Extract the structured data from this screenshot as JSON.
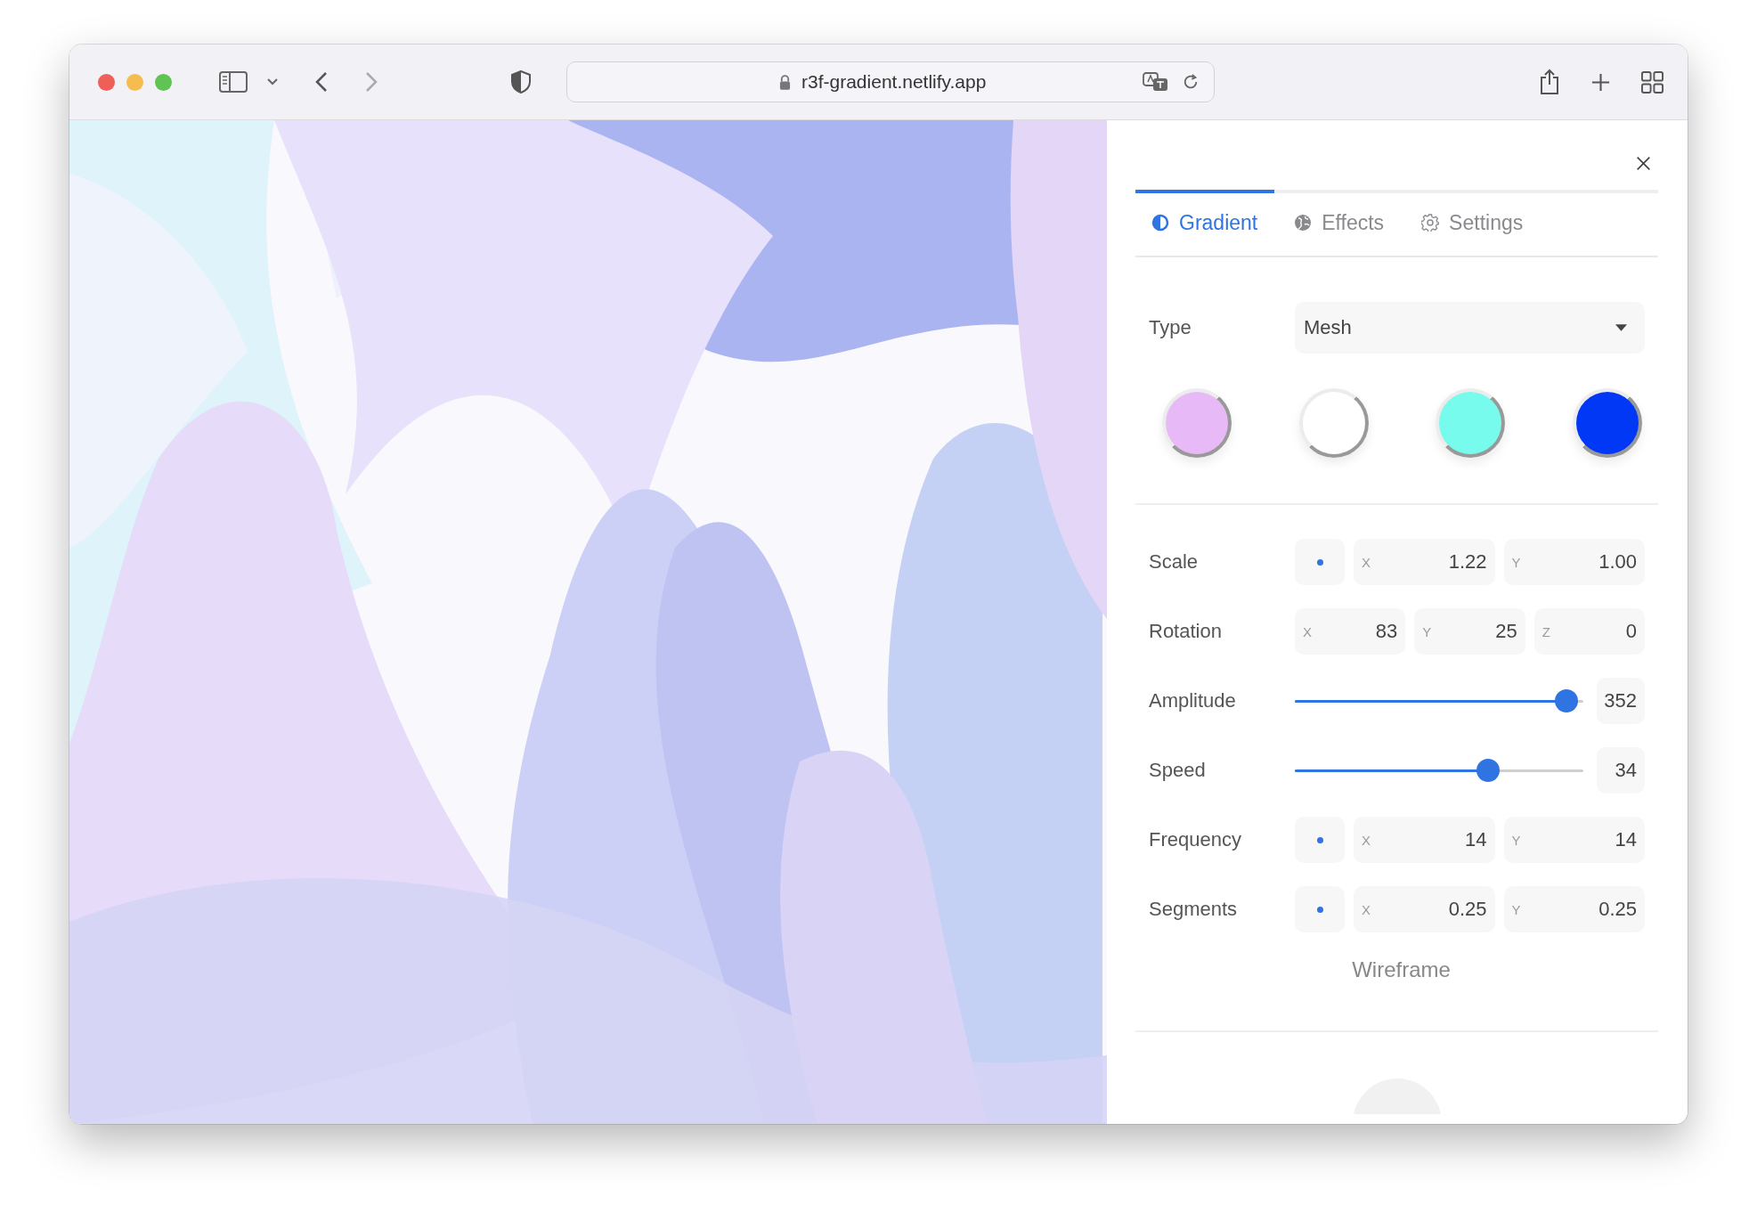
{
  "browser": {
    "url": "r3f-gradient.netlify.app"
  },
  "panel": {
    "tabs": [
      {
        "label": "Gradient",
        "selected": true
      },
      {
        "label": "Effects",
        "selected": false
      },
      {
        "label": "Settings",
        "selected": false
      }
    ],
    "type": {
      "label": "Type",
      "value": "Mesh"
    },
    "swatches": [
      {
        "color": "#e8b9f7"
      },
      {
        "color": "#ffffff"
      },
      {
        "color": "#77fbec"
      },
      {
        "color": "#0038f5"
      }
    ],
    "rows": [
      {
        "kind": "vector",
        "label": "Scale",
        "fields": [
          {
            "axis": "X",
            "value": "1.22"
          },
          {
            "axis": "Y",
            "value": "1.00"
          }
        ]
      },
      {
        "kind": "vector3",
        "label": "Rotation",
        "fields": [
          {
            "axis": "X",
            "value": "83"
          },
          {
            "axis": "Y",
            "value": "25"
          },
          {
            "axis": "Z",
            "value": "0"
          }
        ]
      },
      {
        "kind": "slider",
        "label": "Amplitude",
        "level": 0.94,
        "value": "352"
      },
      {
        "kind": "slider",
        "label": "Speed",
        "level": 0.67,
        "value": "34"
      },
      {
        "kind": "vector",
        "label": "Frequency",
        "fields": [
          {
            "axis": "X",
            "value": "14"
          },
          {
            "axis": "Y",
            "value": "14"
          }
        ]
      },
      {
        "kind": "vector",
        "label": "Segments",
        "fields": [
          {
            "axis": "X",
            "value": "0.25"
          },
          {
            "axis": "Y",
            "value": "0.25"
          }
        ]
      }
    ],
    "wireframe": {
      "label": "Wireframe"
    }
  }
}
